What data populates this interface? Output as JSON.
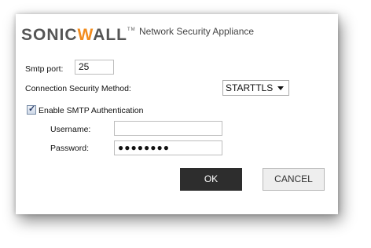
{
  "header": {
    "logo_prefix": "SONIC",
    "logo_w": "W",
    "logo_suffix": "ALL",
    "logo_tm": "TM",
    "subtitle": "Network Security Appliance"
  },
  "form": {
    "smtp_port_label": "Smtp port:",
    "smtp_port_value": "25",
    "security_method_label": "Connection Security Method:",
    "security_method_value": "STARTTLS",
    "enable_auth_label": "Enable SMTP Authentication",
    "enable_auth_checked": true,
    "username_label": "Username:",
    "username_value": "",
    "password_label": "Password:",
    "password_masked": "●●●●●●●●"
  },
  "buttons": {
    "ok_label": "OK",
    "cancel_label": "CANCEL"
  },
  "colors": {
    "brand_accent": "#f28c1e",
    "ok_button_bg": "#2d2d2d",
    "cancel_button_bg": "#eeeeee"
  }
}
